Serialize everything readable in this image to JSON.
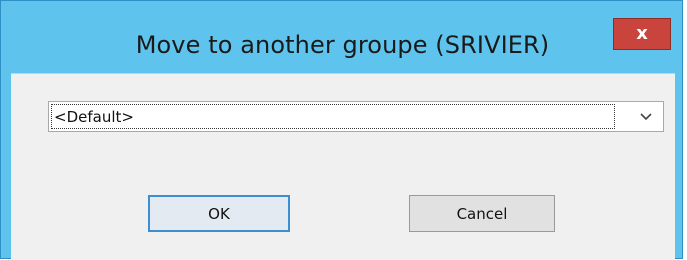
{
  "dialog": {
    "title": "Move to another groupe  (SRIVIER)",
    "close_label": "x"
  },
  "group_select": {
    "selected_value": "<Default>",
    "arrow_icon": "chevron-down-icon"
  },
  "buttons": {
    "ok_label": "OK",
    "cancel_label": "Cancel"
  },
  "colors": {
    "title_bar": "#5fc4ed",
    "close_button": "#c8443d",
    "client_area": "#f0f0f0",
    "default_button_border": "#3c8fd0"
  }
}
